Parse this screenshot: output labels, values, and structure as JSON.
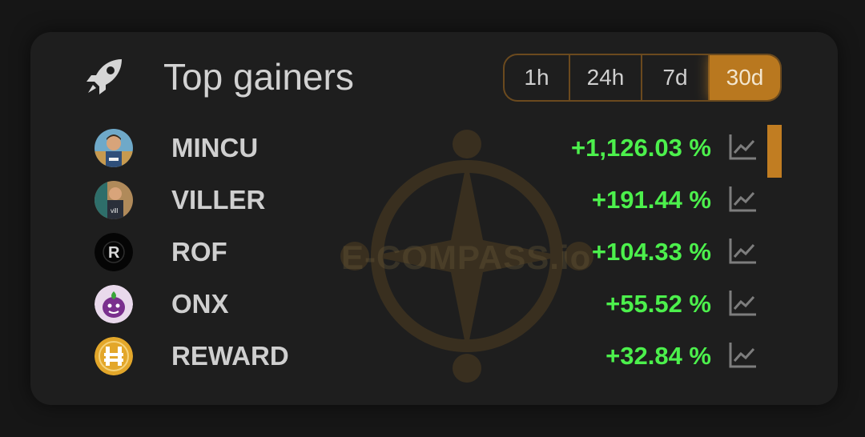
{
  "header": {
    "icon": "rocket-icon",
    "title": "Top gainers",
    "tabs": [
      {
        "label": "1h",
        "active": false
      },
      {
        "label": "24h",
        "active": false
      },
      {
        "label": "7d",
        "active": false
      },
      {
        "label": "30d",
        "active": true
      }
    ]
  },
  "watermark": "E-COMPASS.io",
  "rows": [
    {
      "symbol": "MINCU",
      "change": "+1,126.03 %",
      "avatar": "mincu-avatar"
    },
    {
      "symbol": "VILLER",
      "change": "+191.44 %",
      "avatar": "viller-avatar"
    },
    {
      "symbol": "ROF",
      "change": "+104.33 %",
      "avatar": "rof-avatar"
    },
    {
      "symbol": "ONX",
      "change": "+55.52 %",
      "avatar": "onx-avatar"
    },
    {
      "symbol": "REWARD",
      "change": "+32.84 %",
      "avatar": "reward-avatar"
    }
  ],
  "colors": {
    "accent": "#b9781f",
    "positive": "#4cf04c",
    "text": "#cfcfcf",
    "card": "#1e1e1e"
  }
}
